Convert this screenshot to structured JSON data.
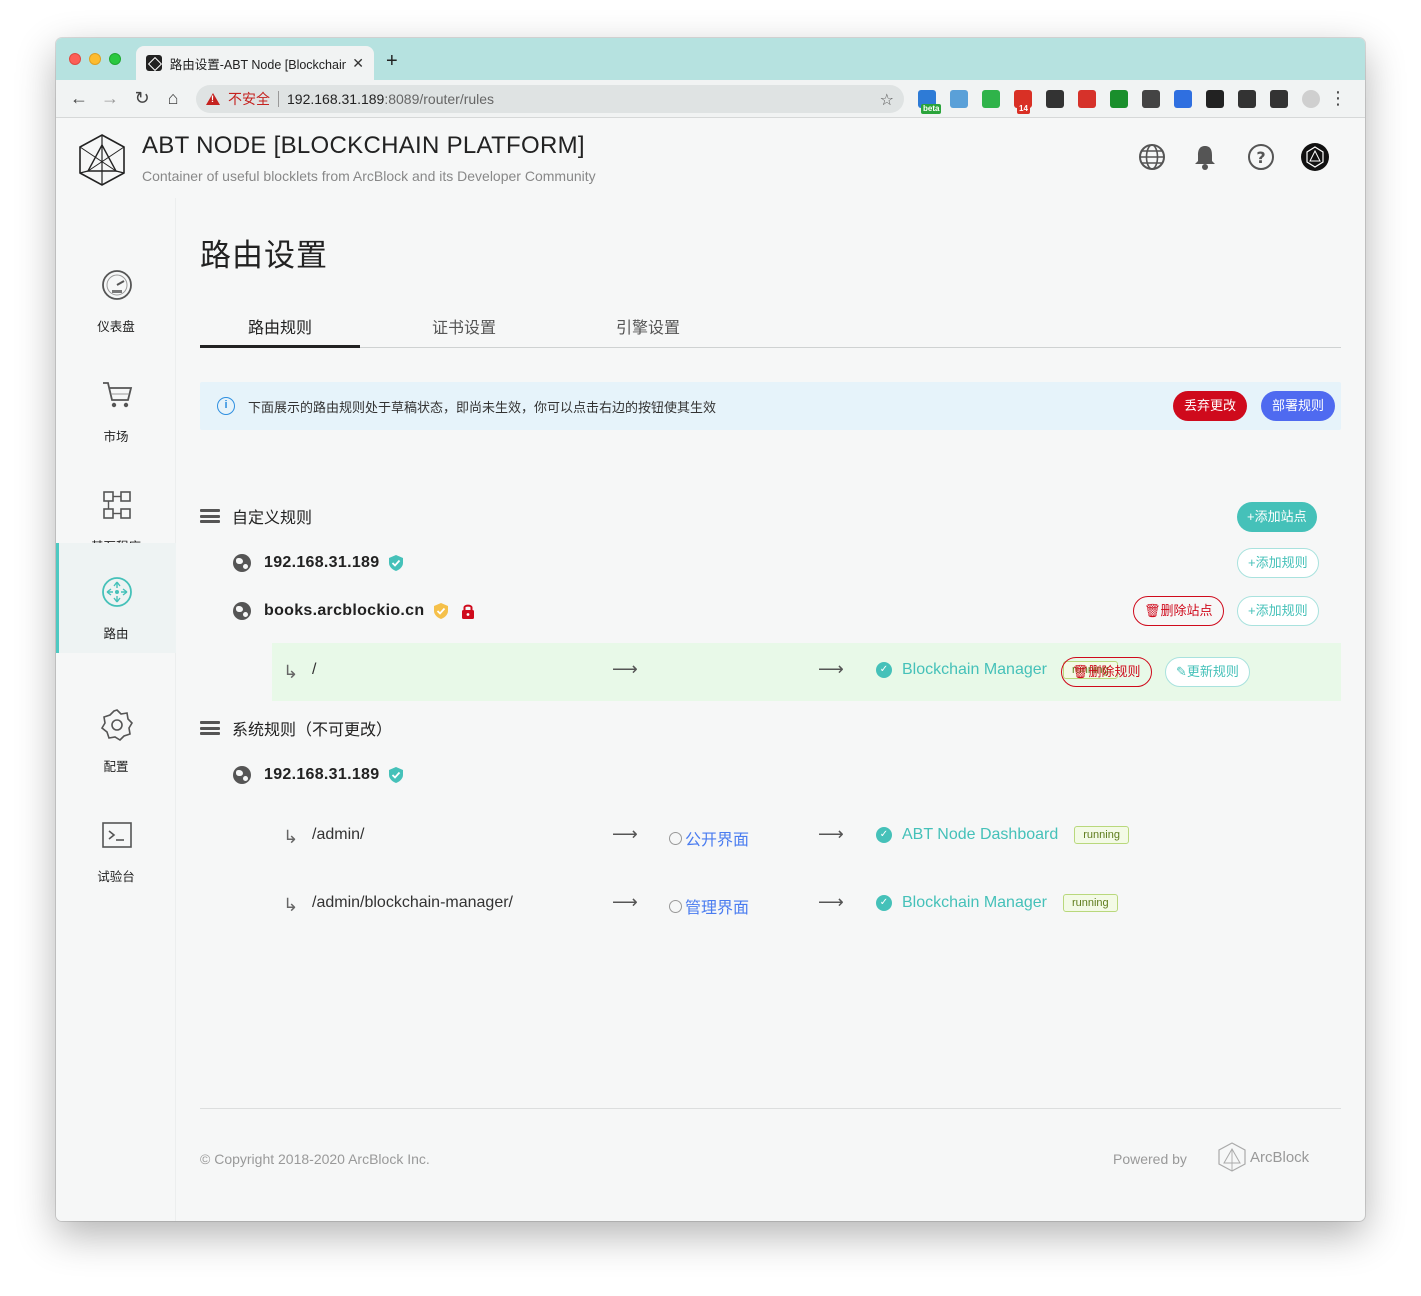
{
  "browser": {
    "tab_title": "路由设置-ABT Node [Blockchain Platform]",
    "insecure_label": "不安全",
    "url_host": "192.168.31.189",
    "url_rest": ":8089/router/rules",
    "extensions": [
      {
        "icon": "beta-extension-icon",
        "badge": "beta",
        "color": "#2e7bd6",
        "badge_color": "#2aa43a"
      },
      {
        "icon": "sheet-extension-icon",
        "color": "#5aa0d8"
      },
      {
        "icon": "evernote-icon",
        "color": "#2fb34a"
      },
      {
        "icon": "gmail-icon",
        "badge": "14",
        "color": "#d93025",
        "badge_color": "#d93025"
      },
      {
        "icon": "news-extension-icon",
        "color": "#333333"
      },
      {
        "icon": "red-extension-icon",
        "color": "#d6322a"
      },
      {
        "icon": "bw-extension-icon",
        "color": "#1a8f2c"
      },
      {
        "icon": "tool-extension-icon",
        "color": "#444444"
      },
      {
        "icon": "screen-extension-icon",
        "color": "#2f6fe0"
      },
      {
        "icon": "function-extension-icon",
        "color": "#222222"
      },
      {
        "icon": "chart-extension-icon",
        "color": "#333333"
      },
      {
        "icon": "puzzle-extensions-icon",
        "color": "#333333"
      },
      {
        "icon": "profile-avatar-icon",
        "color": "#cfcfcf"
      }
    ]
  },
  "header": {
    "title": "ABT NODE [BLOCKCHAIN PLATFORM]",
    "subtitle": "Container of useful blocklets from ArcBlock and its Developer Community"
  },
  "sidebar": {
    "items": [
      {
        "label": "仪表盘",
        "icon": "dashboard-gauge-icon"
      },
      {
        "label": "市场",
        "icon": "shopping-cart-icon"
      },
      {
        "label": "基石程序",
        "icon": "blocklets-nodes-icon"
      },
      {
        "label": "路由",
        "icon": "router-arrows-icon",
        "active": true
      },
      {
        "label": "配置",
        "icon": "settings-gear-icon"
      },
      {
        "label": "试验台",
        "icon": "terminal-icon"
      }
    ]
  },
  "page": {
    "title": "路由设置",
    "tabs": [
      "路由规则",
      "证书设置",
      "引擎设置"
    ],
    "active_tab": 0
  },
  "banner": {
    "text": "下面展示的路由规则处于草稿状态，即尚未生效，你可以点击右边的按钮使其生效",
    "discard_label": "丢弃更改",
    "deploy_label": "部署规则"
  },
  "custom": {
    "title": "自定义规则",
    "add_site_label": "添加站点",
    "sites": [
      {
        "name": "192.168.31.189",
        "add_rule_label": "添加规则"
      },
      {
        "name": "books.arcblockio.cn",
        "delete_site_label": "删除站点",
        "add_rule_label": "添加规则"
      }
    ],
    "rule": {
      "path": "/",
      "target": "Blockchain Manager",
      "status": "running",
      "delete_rule_label": "删除规则",
      "update_rule_label": "更新规则"
    }
  },
  "system": {
    "title": "系统规则（不可更改）",
    "site": "192.168.31.189",
    "rules": [
      {
        "path": "/admin/",
        "interface": "公开界面",
        "target": "ABT Node Dashboard",
        "status": "running"
      },
      {
        "path": "/admin/blockchain-manager/",
        "interface": "管理界面",
        "target": "Blockchain Manager",
        "status": "running"
      }
    ]
  },
  "footer": {
    "copyright": "© Copyright 2018-2020  ArcBlock Inc.",
    "powered_by": "Powered by",
    "brand": "ArcBlock"
  },
  "colors": {
    "accent_teal": "#45c1b9",
    "danger_red": "#cf0a1c",
    "primary_blue": "#4f6af0",
    "link_blue": "#4a7cf0",
    "chrome_teal": "#b6e2e0"
  }
}
